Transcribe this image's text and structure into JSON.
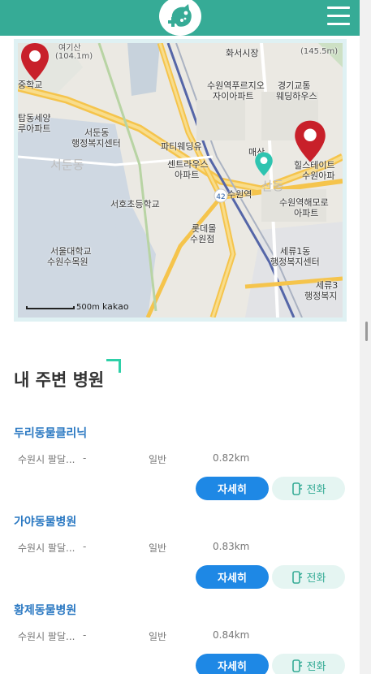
{
  "map": {
    "labels": {
      "yeogisan": "여기산",
      "yeogisan_elev": "(104.1m)",
      "right_top_elev": "(145.5m)",
      "hwaseo_market": "화서시장",
      "school_left": "중학교",
      "sunwon_station_apt": "수원역푸르지오",
      "sunwon_station_apt2": "자이아파트",
      "kyunggi": "경기교통",
      "kyunggi2": "웨딩하우스",
      "maetan_apt": "탑동세양",
      "maetan_apt2": "루아파트",
      "seodun_office": "서둔동",
      "seodun_office2": "행정복지센터",
      "party_wedding": "파티웨딩유",
      "seodun_dong": "서둔동",
      "central_apt": "센트라우스",
      "central_apt2": "아파트",
      "maesan": "매산",
      "estate": "힐스테이트",
      "estate2": "수원아파",
      "seoho_school": "서호초등학교",
      "suwon_station": "수원역",
      "sanong": "산동",
      "suwon_haemaro": "수원역해모로",
      "suwon_haemaro2": "아파트",
      "lotte": "롯데몰",
      "lotte2": "수원점",
      "snu_arboretum": "서울대학교",
      "snu_arboretum2": "수원수목원",
      "seryu1": "세류1동",
      "seryu1_2": "행정복지센터",
      "seryu3": "세류3",
      "seryu3_2": "행정복지",
      "route": "42",
      "scale": "500m",
      "kakao": "kakao"
    }
  },
  "section": {
    "title": "내 주변 병원"
  },
  "hospitals": [
    {
      "name": "두리동물클리닉",
      "address": "수원시 팔달...",
      "dash": "-",
      "type": "일반",
      "distance": "0.82km",
      "detail_label": "자세히",
      "call_label": "전화"
    },
    {
      "name": "가야동물병원",
      "address": "수원시 팔달...",
      "dash": "-",
      "type": "일반",
      "distance": "0.83km",
      "detail_label": "자세히",
      "call_label": "전화"
    },
    {
      "name": "황제동물병원",
      "address": "수원시 팔달...",
      "dash": "-",
      "type": "일반",
      "distance": "0.84km",
      "detail_label": "자세히",
      "call_label": "전화"
    }
  ],
  "colors": {
    "header": "#36ab96",
    "accent": "#2ed0a8",
    "link": "#2a78c2",
    "button": "#1e88e5",
    "marker": "#c8202a"
  },
  "icons": {
    "logo": "pet-hospital-logo-icon",
    "menu": "hamburger-menu-icon",
    "marker": "map-marker-icon",
    "phone": "phone-icon"
  }
}
